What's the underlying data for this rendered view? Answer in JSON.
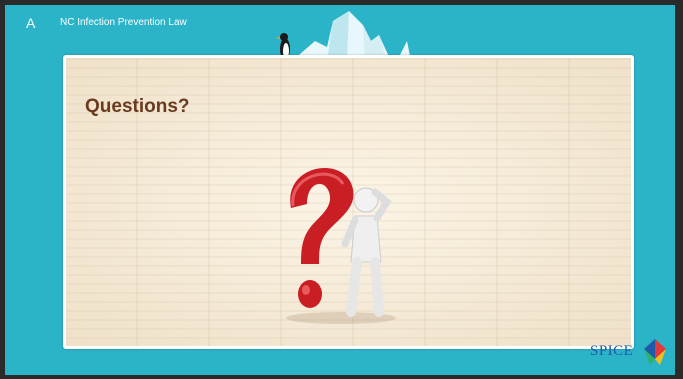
{
  "slide": {
    "letter": "A",
    "header_title": "NC Infection Prevention Law"
  },
  "panel": {
    "title": "Questions?"
  },
  "logo": {
    "name": "SPICE"
  },
  "colors": {
    "slide_background": "#2bb3c8",
    "title_text": "#6b3a1f",
    "question_mark": "#c81e24",
    "logo_blue": "#1f5aa8"
  },
  "icons": [
    "penguin-icon",
    "iceberg-icon",
    "question-mark-icon",
    "thinking-figure-icon",
    "spice-logo-icon"
  ]
}
